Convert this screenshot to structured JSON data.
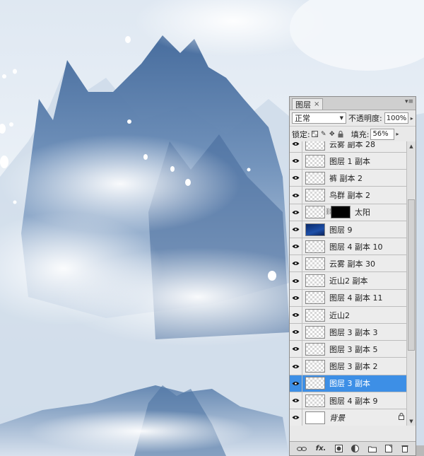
{
  "panel": {
    "tab_label": "图层",
    "close_glyph": "×",
    "menu_glyph": "▾≡",
    "blend_mode": "正常",
    "opacity_label": "不透明度:",
    "opacity_value": "100%",
    "lock_label": "锁定:",
    "fill_label": "填充:",
    "fill_value": "56%"
  },
  "layers": [
    {
      "name": "云雾 副本 28",
      "thumb": "transparent"
    },
    {
      "name": "图层 1 副本",
      "thumb": "transparent"
    },
    {
      "name": "裤 副本 2",
      "thumb": "transparent"
    },
    {
      "name": "鸟群 副本 2",
      "thumb": "transparent"
    },
    {
      "name": "太阳",
      "thumb": "transparent",
      "mask": true
    },
    {
      "name": "图层 9",
      "thumb": "dark"
    },
    {
      "name": "图层 4 副本 10",
      "thumb": "transparent"
    },
    {
      "name": "云雾 副本 30",
      "thumb": "transparent"
    },
    {
      "name": "近山2 副本",
      "thumb": "transparent"
    },
    {
      "name": "图层 4 副本 11",
      "thumb": "transparent"
    },
    {
      "name": "近山2",
      "thumb": "transparent"
    },
    {
      "name": "图层 3 副本 3",
      "thumb": "transparent"
    },
    {
      "name": "图层 3 副本 5",
      "thumb": "transparent"
    },
    {
      "name": "图层 3 副本 2",
      "thumb": "transparent"
    },
    {
      "name": "图层 3 副本",
      "thumb": "transparent",
      "selected": true
    },
    {
      "name": "图层 4 副本 9",
      "thumb": "transparent"
    },
    {
      "name": "背景",
      "thumb": "white",
      "italic": true,
      "locked": true
    }
  ],
  "colors": {
    "selection": "#3d8fe6",
    "panel_bg": "#e9e9e9",
    "sky": "#eef3f8",
    "mountain_dark": "#3a5e8f"
  },
  "icons": [
    "eye-icon",
    "link-icon",
    "fx-icon",
    "mask-icon",
    "adjustment-icon",
    "folder-icon",
    "new-layer-icon",
    "trash-icon",
    "lock-icon"
  ]
}
